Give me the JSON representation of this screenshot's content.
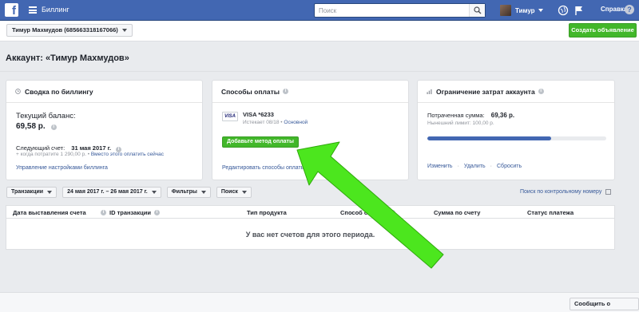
{
  "app": {
    "title": "Биллинг"
  },
  "search": {
    "placeholder": "Поиск"
  },
  "user": {
    "name": "Тимур"
  },
  "help": {
    "label": "Справка",
    "icon_glyph": "?"
  },
  "account_selector": {
    "label": "Тимур Махмудов (685663318167066)"
  },
  "create_ad_button": "Создать объявление",
  "page_title": "Аккаунт: «Тимур Махмудов»",
  "billing_summary": {
    "title": "Сводка по биллингу",
    "balance_label": "Текущий баланс:",
    "balance_value": "69,58 р.",
    "next_invoice_label": "Следующий счет:",
    "next_invoice_date": "31 мая 2017 г.",
    "spend_note": "+ когда потратите 1 290,00 р. •",
    "pay_now_link": "Вместо этого оплатить сейчас",
    "manage_link": "Управление настройками биллинга"
  },
  "payment_methods": {
    "title": "Способы оплаты",
    "card_brand": "VISA",
    "card_name": "VISA *6233",
    "card_expiry": "Истекает 08/18 •",
    "card_primary": "Основной",
    "add_button": "Добавьте метод оплаты",
    "edit_link": "Редактировать способы оплаты"
  },
  "spend_limit": {
    "title": "Ограничение затрат аккаунта",
    "spent_label": "Потраченная сумма:",
    "spent_value": "69,36 р.",
    "current_limit": "Нынешний лимит: 100,00 р.",
    "progress": 0.69,
    "actions": [
      "Изменить",
      "Удалить",
      "Сбросить"
    ]
  },
  "filters": {
    "transactions": "Транзакции",
    "date_range": "24 мая 2017 г. – 26 мая 2017 г.",
    "filters": "Фильтры",
    "search": "Поиск",
    "search_by_number": "Поиск по контрольному номеру"
  },
  "table": {
    "columns": [
      "Дата выставления счета",
      "ID транзакции",
      "Тип продукта",
      "Способ оплаты",
      "Сумма по счету",
      "Статус платежа"
    ],
    "empty_message": "У вас нет счетов для этого периода."
  },
  "footer": {
    "report_button": "Сообщить о проблеме"
  },
  "colors": {
    "topbar": "#4267b2",
    "create_button": "#42b72a",
    "progress": "#4267b2",
    "annotation_arrow": "#4ce61e"
  }
}
